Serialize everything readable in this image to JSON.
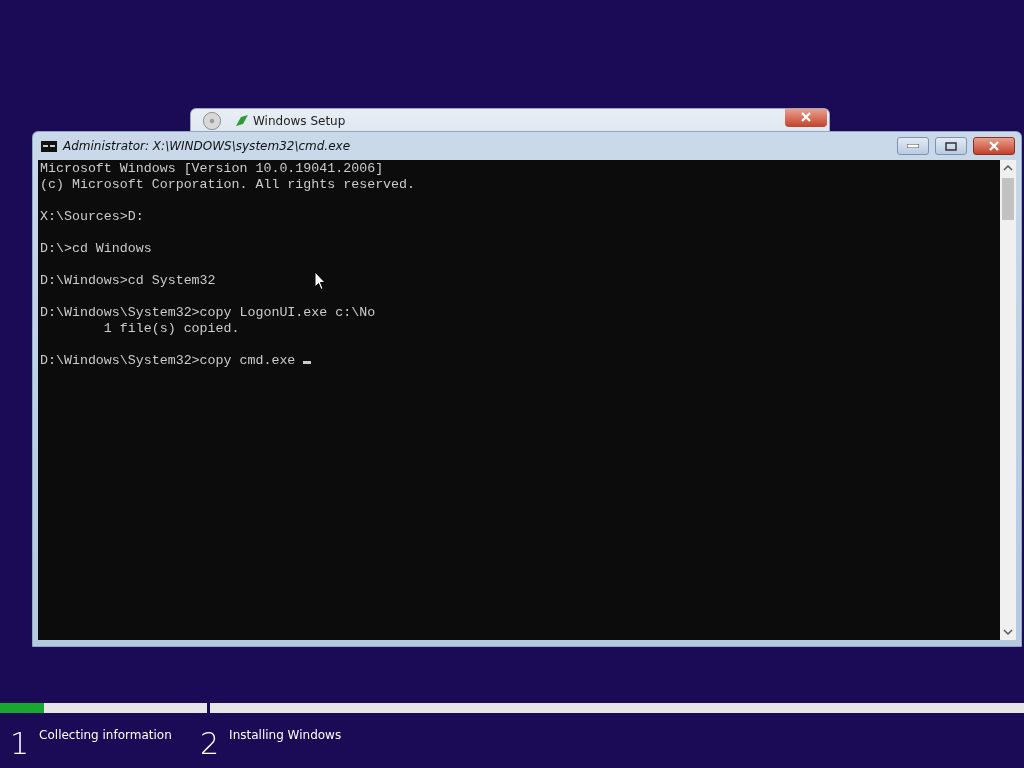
{
  "background_window": {
    "title": "Windows Setup"
  },
  "console_window": {
    "title": "Administrator: X:\\WINDOWS\\system32\\cmd.exe",
    "blocks": [
      [
        "Microsoft Windows [Version 10.0.19041.2006]",
        "(c) Microsoft Corporation. All rights reserved."
      ],
      [
        "X:\\Sources>D:"
      ],
      [
        "D:\\>cd Windows"
      ],
      [
        "D:\\Windows>cd System32"
      ],
      [
        "D:\\Windows\\System32>copy LogonUI.exe c:\\No",
        "        1 file(s) copied."
      ],
      [
        "D:\\Windows\\System32>copy cmd.exe "
      ]
    ]
  },
  "progress": {
    "level": 0.043
  },
  "steps": [
    {
      "number": "1",
      "label": "Collecting information"
    },
    {
      "number": "2",
      "label": "Installing Windows"
    }
  ]
}
